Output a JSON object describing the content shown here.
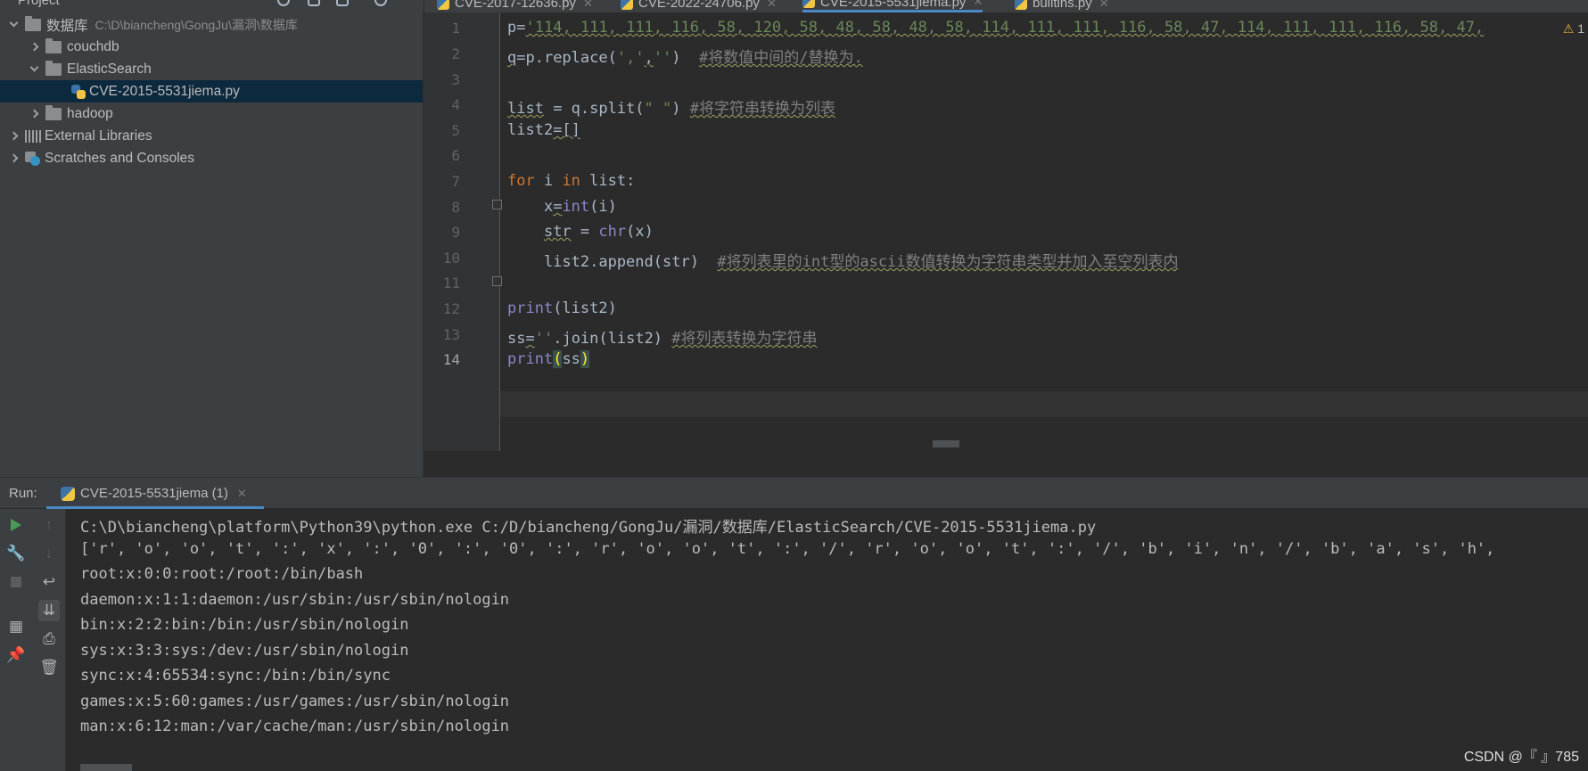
{
  "project_panel": {
    "title": "Project",
    "tree": [
      {
        "label": "数据库",
        "path": "C:\\D\\biancheng\\GongJu\\漏洞\\数据库"
      },
      {
        "label": "couchdb"
      },
      {
        "label": "ElasticSearch"
      },
      {
        "label": "CVE-2015-5531jiema.py"
      },
      {
        "label": "hadoop"
      },
      {
        "label": "External Libraries"
      },
      {
        "label": "Scratches and Consoles"
      }
    ]
  },
  "editor_tabs": [
    {
      "label": "CVE-2017-12636.py"
    },
    {
      "label": "CVE-2022-24706.py"
    },
    {
      "label": "CVE-2015-5531jiema.py"
    },
    {
      "label": "builtins.py"
    }
  ],
  "editor": {
    "warning_count": "1",
    "line_numbers": [
      "1",
      "2",
      "3",
      "4",
      "5",
      "6",
      "7",
      "8",
      "9",
      "10",
      "11",
      "12",
      "13",
      "14"
    ],
    "current_line": "14",
    "code": {
      "l1_var": "p",
      "l1_eq": "=",
      "l1_str": "'114, 111, 111, 116, 58, 120, 58, 48, 58, 48, 58, 114, 111, 111, 116, 58, 47, 114, 111, 111, 116, 58, 47,",
      "l2_a": "q",
      "l2_b": "=p.replace(",
      "l2_s1": "','",
      "l2_c": ",",
      "l2_s2": "''",
      "l2_d": ")  ",
      "l2_cmt": "#将数值中间的/替换为.",
      "l4_a": "list",
      "l4_b": " = q.split(",
      "l4_s": "\" \"",
      "l4_c": ") ",
      "l4_cmt": "#将字符串转换为列表",
      "l5_a": "list2",
      "l5_b": "=[]",
      "l7_kw1": "for",
      "l7_a": " i ",
      "l7_kw2": "in",
      "l7_b": " list:",
      "l8_a": "    x",
      "l8_b": "=",
      "l8_bi": "int",
      "l8_c": "(i)",
      "l9_a": "    ",
      "l9_b": "str",
      "l9_c": " = ",
      "l9_bi": "chr",
      "l9_d": "(x)",
      "l10_a": "    list2.append(str)  ",
      "l10_cmt": "#将列表里的int型的ascii数值转换为字符串类型并加入至空列表内",
      "l12_bi": "print",
      "l12_a": "(list2)",
      "l13_a": "ss",
      "l13_b": "=",
      "l13_s": "''",
      "l13_c": ".join(list2) ",
      "l13_cmt": "#将列表转换为字符串",
      "l14_bi": "print",
      "l14_p1": "(",
      "l14_a": "ss",
      "l14_p2": ")"
    }
  },
  "run": {
    "label": "Run:",
    "tab_label": "CVE-2015-5531jiema (1)",
    "console_lines": [
      "C:\\D\\biancheng\\platform\\Python39\\python.exe C:/D/biancheng/GongJu/漏洞/数据库/ElasticSearch/CVE-2015-5531jiema.py",
      "['r', 'o', 'o', 't', ':', 'x', ':', '0', ':', '0', ':', 'r', 'o', 'o', 't', ':', '/', 'r', 'o', 'o', 't', ':', '/', 'b', 'i', 'n', '/', 'b', 'a', 's', 'h',",
      "root:x:0:0:root:/root:/bin/bash",
      "daemon:x:1:1:daemon:/usr/sbin:/usr/sbin/nologin",
      "bin:x:2:2:bin:/bin:/usr/sbin/nologin",
      "sys:x:3:3:sys:/dev:/usr/sbin/nologin",
      "sync:x:4:65534:sync:/bin:/bin/sync",
      "games:x:5:60:games:/usr/games:/usr/sbin/nologin",
      "man:x:6:12:man:/var/cache/man:/usr/sbin/nologin"
    ]
  },
  "watermark": "CSDN @『   』785"
}
